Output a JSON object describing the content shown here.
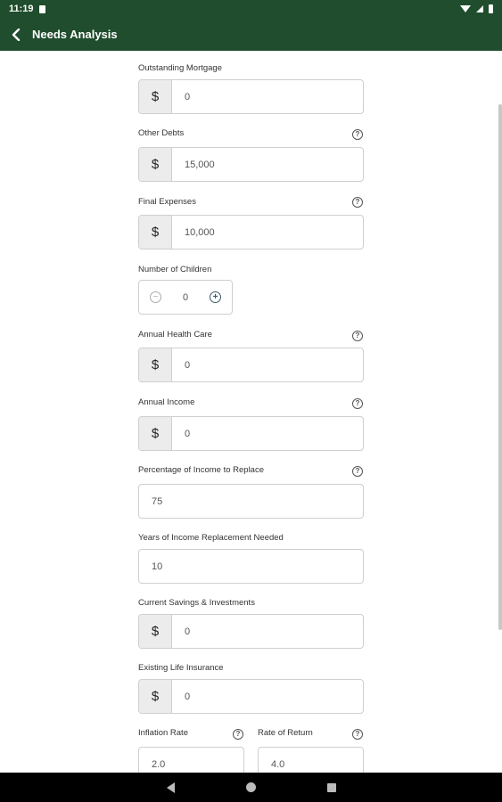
{
  "status_bar": {
    "time": "11:19"
  },
  "app_bar": {
    "title": "Needs Analysis"
  },
  "currency_symbol": "$",
  "help_glyph": "?",
  "fields": {
    "outstanding_mortgage": {
      "label": "Outstanding Mortgage",
      "value": "0"
    },
    "other_debts": {
      "label": "Other Debts",
      "value": "15,000"
    },
    "final_expenses": {
      "label": "Final Expenses",
      "value": "10,000"
    },
    "number_of_children": {
      "label": "Number of Children",
      "value": "0",
      "minus": "−",
      "plus": "+"
    },
    "annual_health_care": {
      "label": "Annual Health Care",
      "value": "0"
    },
    "annual_income": {
      "label": "Annual Income",
      "value": "0"
    },
    "pct_income_replace": {
      "label": "Percentage of Income to Replace",
      "value": "75"
    },
    "years_replacement": {
      "label": "Years of Income Replacement Needed",
      "value": "10"
    },
    "current_savings": {
      "label": "Current Savings & Investments",
      "value": "0"
    },
    "existing_life_insurance": {
      "label": "Existing Life Insurance",
      "value": "0"
    },
    "inflation_rate": {
      "label": "Inflation Rate",
      "value": "2.0"
    },
    "rate_of_return": {
      "label": "Rate of Return",
      "value": "4.0"
    }
  },
  "colors": {
    "app_bar": "#1f4d2d",
    "nav_bar": "#000000",
    "prefix_bg": "#ececec"
  }
}
